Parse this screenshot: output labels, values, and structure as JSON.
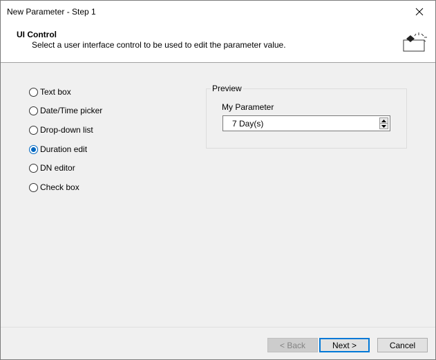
{
  "window": {
    "title": "New Parameter - Step 1"
  },
  "header": {
    "title": "UI Control",
    "description": "Select a user interface control to be used to edit the parameter value.",
    "icon": "control-wizard-icon"
  },
  "controls": {
    "options": [
      {
        "label": "Text box",
        "checked": false
      },
      {
        "label": "Date/Time picker",
        "checked": false
      },
      {
        "label": "Drop-down list",
        "checked": false
      },
      {
        "label": "Duration edit",
        "checked": true
      },
      {
        "label": "DN editor",
        "checked": false
      },
      {
        "label": "Check box",
        "checked": false
      }
    ]
  },
  "preview": {
    "legend": "Preview",
    "param_label": "My Parameter",
    "value": "7 Day(s)"
  },
  "footer": {
    "back_label": "< Back",
    "next_label": "Next >",
    "cancel_label": "Cancel"
  },
  "colors": {
    "accent": "#0067c0",
    "default_button_border": "#0078d7"
  }
}
